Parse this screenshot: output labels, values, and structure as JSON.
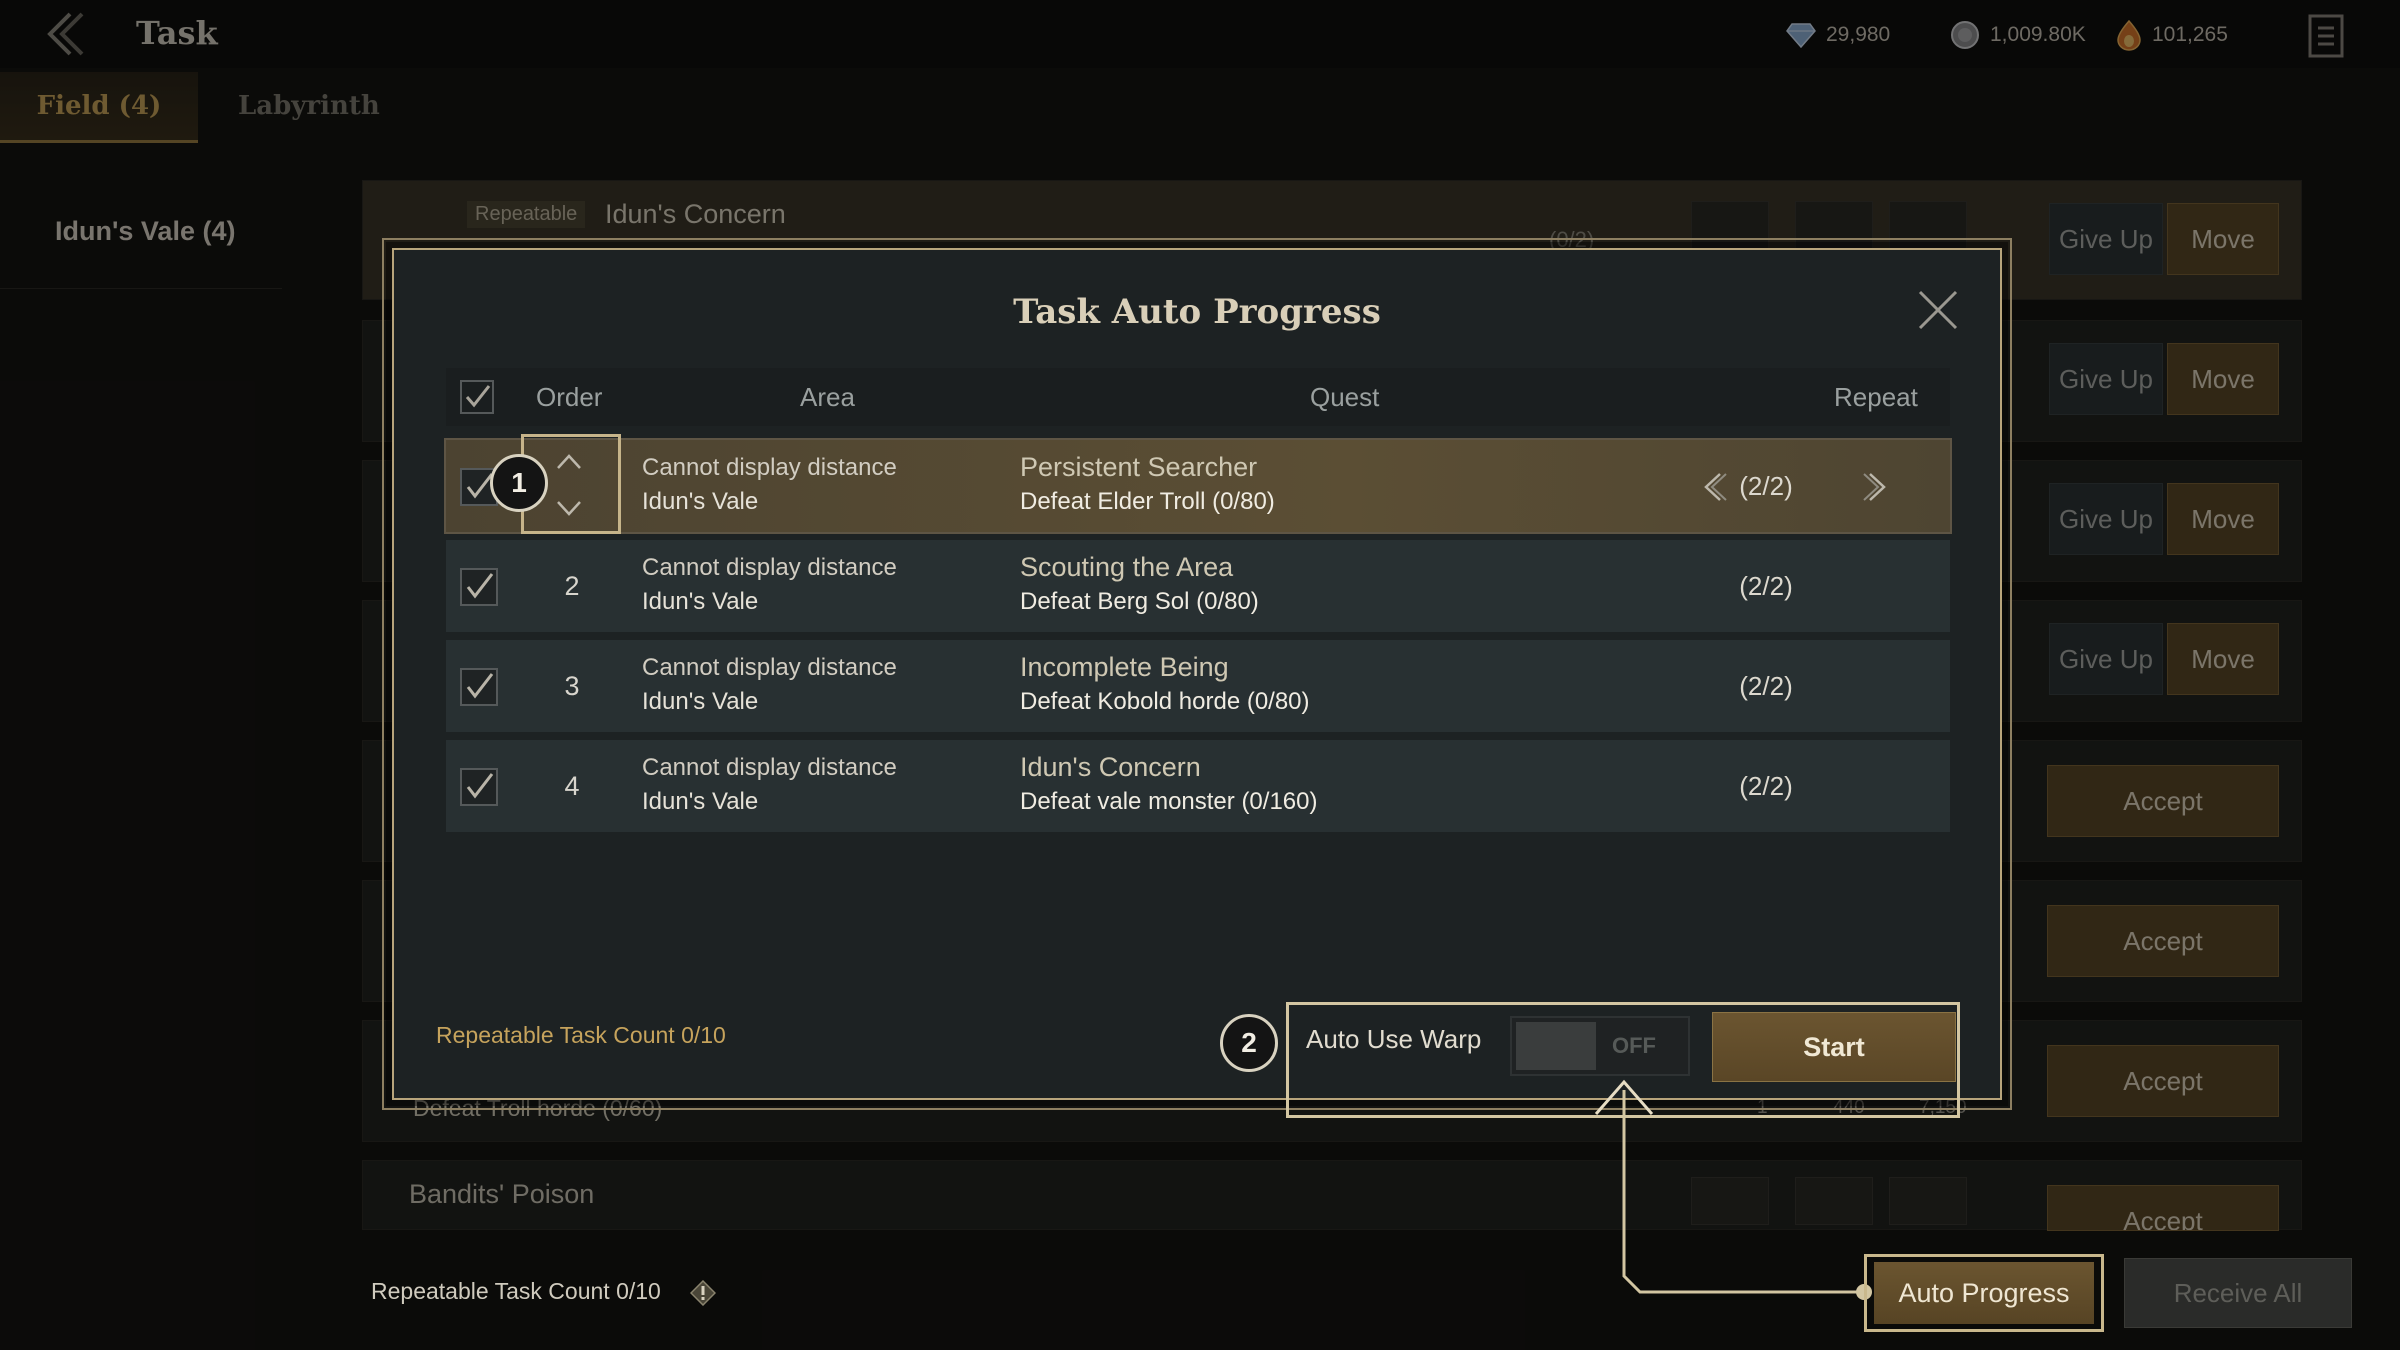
{
  "header": {
    "title": "Task",
    "currencies": [
      {
        "icon": "diamond-icon",
        "value": "29,980"
      },
      {
        "icon": "silver-coin-icon",
        "value": "1,009.80K"
      },
      {
        "icon": "fire-gem-icon",
        "value": "101,265"
      }
    ]
  },
  "tabs": [
    {
      "label": "Field (4)",
      "active": true
    },
    {
      "label": "Labyrinth",
      "active": false
    }
  ],
  "sidebar": {
    "items": [
      {
        "label": "Idun's Vale (4)"
      }
    ]
  },
  "background_list": {
    "first_row": {
      "tag": "Repeatable",
      "title": "Idun's Concern",
      "progress": "(0/2)"
    },
    "partial_row_text": "Defeat Troll horde (0/60)",
    "partial_row_rewards": [
      "1",
      "440",
      "7,150"
    ],
    "last_row_title": "Bandits' Poison",
    "give_up_label": "Give Up",
    "move_label": "Move",
    "accept_label": "Accept"
  },
  "dialog": {
    "title": "Task Auto Progress",
    "columns": {
      "order": "Order",
      "area": "Area",
      "quest": "Quest",
      "repeat": "Repeat"
    },
    "rows": [
      {
        "order": "1",
        "distance": "Cannot display distance",
        "area": "Idun's Vale",
        "quest": "Persistent Searcher",
        "objective": "Defeat Elder Troll (0/80)",
        "repeat": "(2/2)",
        "selected": true
      },
      {
        "order": "2",
        "distance": "Cannot display distance",
        "area": "Idun's Vale",
        "quest": "Scouting the Area",
        "objective": "Defeat Berg Sol (0/80)",
        "repeat": "(2/2)",
        "selected": false
      },
      {
        "order": "3",
        "distance": "Cannot display distance",
        "area": "Idun's Vale",
        "quest": "Incomplete Being",
        "objective": "Defeat Kobold horde (0/80)",
        "repeat": "(2/2)",
        "selected": false
      },
      {
        "order": "4",
        "distance": "Cannot display distance",
        "area": "Idun's Vale",
        "quest": "Idun's Concern",
        "objective": "Defeat vale monster (0/160)",
        "repeat": "(2/2)",
        "selected": false
      }
    ],
    "repeatable_count": "Repeatable Task Count 0/10",
    "auto_use_warp_label": "Auto Use Warp",
    "toggle_state": "OFF",
    "start_label": "Start",
    "callouts": [
      "1",
      "2"
    ]
  },
  "footer": {
    "repeatable_count": "Repeatable Task Count 0/10",
    "auto_progress_label": "Auto Progress",
    "receive_all_label": "Receive All"
  },
  "colors": {
    "accent_gold": "#c9a55a",
    "dialog_border": "#b8a57c",
    "button_gold": "#5a4727"
  }
}
